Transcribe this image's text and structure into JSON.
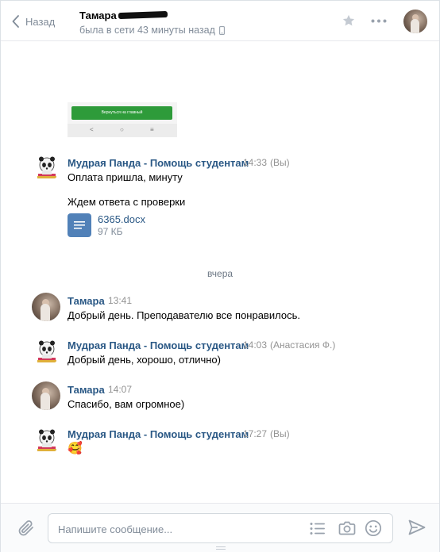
{
  "header": {
    "back_label": "Назад",
    "peer_name": "Тамара",
    "peer_status": "была в сети 43 минуты назад"
  },
  "preview": {
    "button_text": "Вернуться на главный"
  },
  "messages": [
    {
      "author": "Мудрая Панда - Помощь студентам",
      "time": "14:33",
      "sender_note": "(Вы)",
      "lines": [
        "Оплата пришла, минуту",
        "Ждем ответа с проверки"
      ],
      "attachment": {
        "name": "6365.docx",
        "size": "97 КБ"
      }
    },
    {
      "author": "Тамара",
      "time": "13:41",
      "lines": [
        "Добрый день. Преподавателю все понравилось."
      ]
    },
    {
      "author": "Мудрая Панда - Помощь студентам",
      "time": "14:03",
      "sender_note": "(Анастасия Ф.)",
      "lines": [
        "Добрый день, хорошо, отлично)"
      ]
    },
    {
      "author": "Тамара",
      "time": "14:07",
      "lines": [
        "Спасибо, вам огромное)"
      ]
    },
    {
      "author": "Мудрая Панда - Помощь студентам",
      "time": "17:27",
      "sender_note": "(Вы)",
      "lines": [
        "🥰"
      ]
    }
  ],
  "date_separator": "вчера",
  "composer": {
    "placeholder": "Напишите сообщение..."
  },
  "colors": {
    "link": "#2a5885",
    "muted": "#818c99",
    "doc_icon": "#5181b8",
    "preview_button": "#2e9b3a"
  }
}
